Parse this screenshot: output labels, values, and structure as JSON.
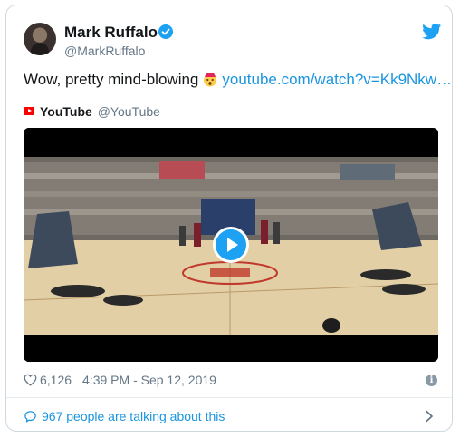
{
  "tweet": {
    "author_name": "Mark Ruffalo",
    "author_handle": "@MarkRuffalo",
    "text_before_emoji": "Wow, pretty mind-blowing",
    "emoji_icon": "exploding-head-icon",
    "link_text": "youtube.com/watch?v=Kk9Nkw…",
    "source_name": "YouTube",
    "source_handle": "@YouTube",
    "like_count": "6,126",
    "timestamp": "4:39 PM - Sep 12, 2019",
    "info_glyph": "i",
    "conversation_text": "967 people are talking about this"
  },
  "colors": {
    "brand_blue": "#1b95e0",
    "youtube_red": "#ff0000",
    "muted_text": "#657786",
    "border": "#cfd9de"
  },
  "icons": {
    "verified": "verified-badge-icon",
    "twitter": "twitter-bird-icon",
    "play": "play-icon",
    "like": "heart-icon",
    "info": "info-icon",
    "conversation": "speech-bubble-icon",
    "chevron": "chevron-right-icon"
  }
}
